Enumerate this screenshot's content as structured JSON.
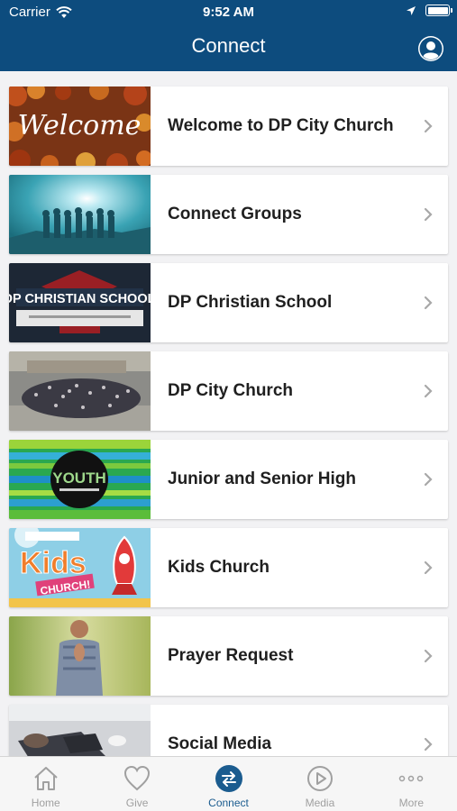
{
  "status_bar": {
    "carrier": "Carrier",
    "time": "9:52 AM"
  },
  "header": {
    "title": "Connect"
  },
  "items": [
    {
      "label": "Welcome to DP City Church",
      "thumb_text": "Welcome"
    },
    {
      "label": "Connect Groups"
    },
    {
      "label": "DP Christian School",
      "thumb_text": "DP CHRISTIAN SCHOOL"
    },
    {
      "label": "DP City Church"
    },
    {
      "label": "Junior and Senior High",
      "thumb_text": "YOUTH"
    },
    {
      "label": "Kids Church",
      "thumb_text": "Kids",
      "thumb_text2": "CHURCH!"
    },
    {
      "label": "Prayer Request"
    },
    {
      "label": "Social Media"
    }
  ],
  "tabs": [
    {
      "label": "Home",
      "icon": "home-icon"
    },
    {
      "label": "Give",
      "icon": "heart-icon"
    },
    {
      "label": "Connect",
      "icon": "connect-icon",
      "active": true
    },
    {
      "label": "Media",
      "icon": "play-icon"
    },
    {
      "label": "More",
      "icon": "more-icon"
    }
  ],
  "colors": {
    "header": "#0d4c7e",
    "active_tab": "#1b5c8f",
    "inactive_tab": "#a0a0a0"
  }
}
